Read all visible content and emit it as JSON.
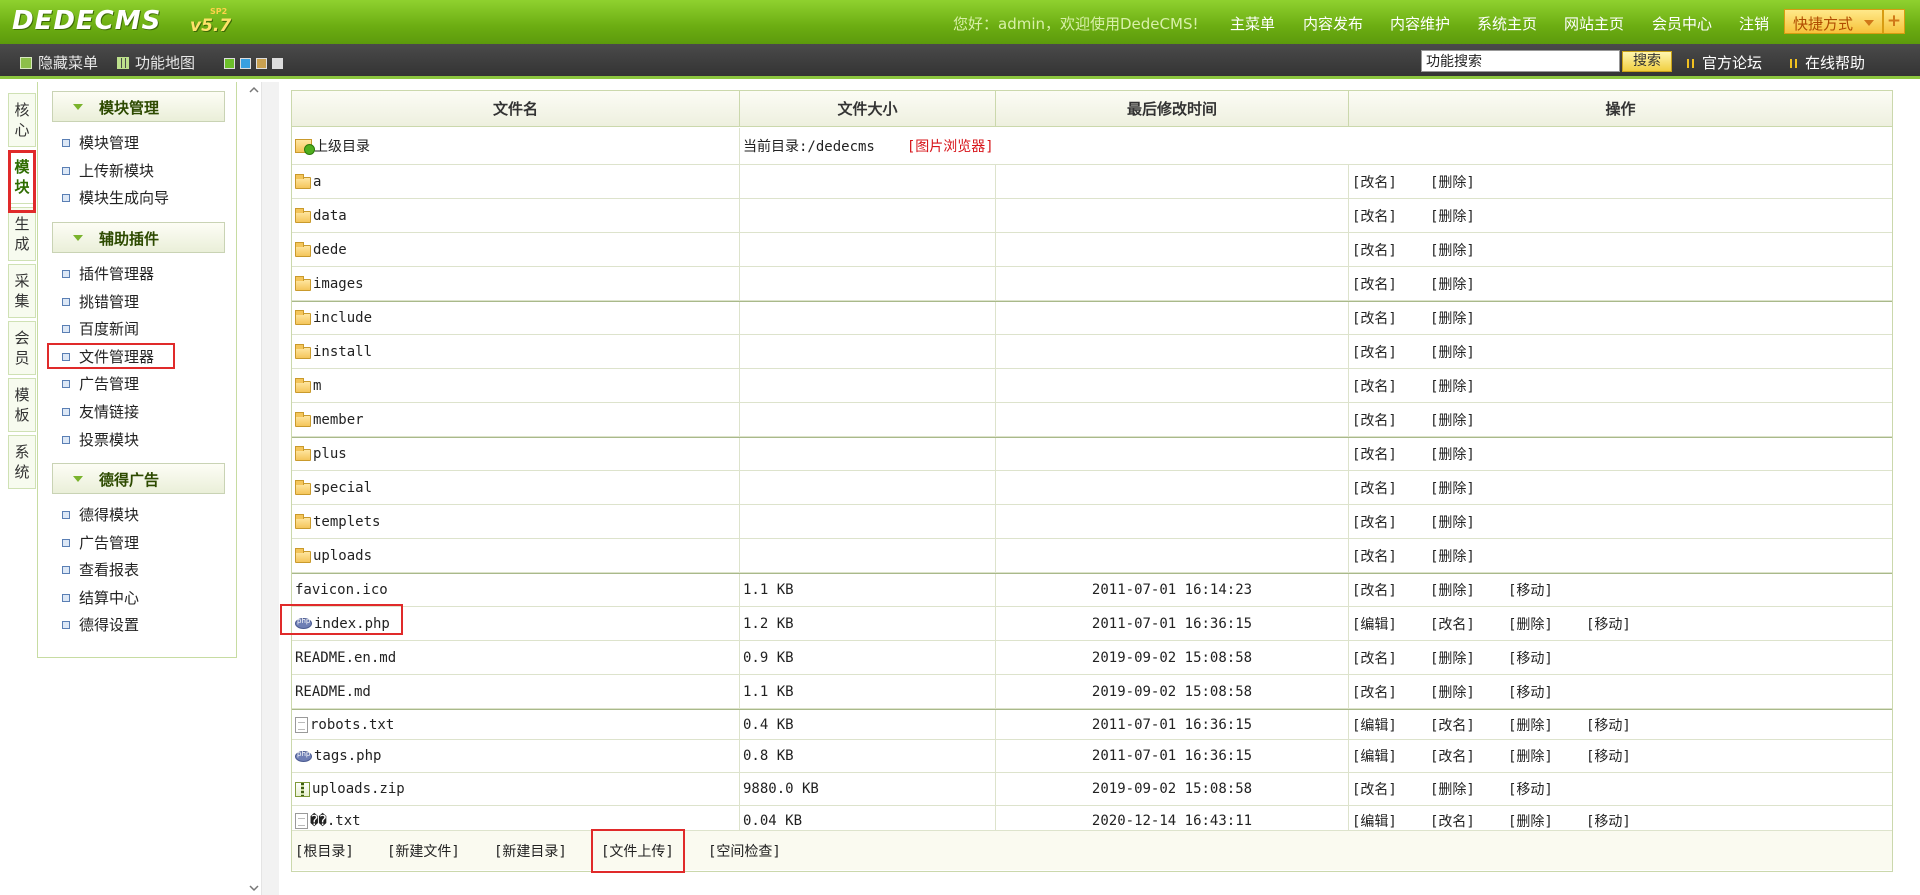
{
  "header": {
    "logo": "DEDECMS",
    "version": "v5.7",
    "version_tag": "SP2",
    "welcome": "您好：admin，欢迎使用DedeCMS!",
    "nav": [
      "主菜单",
      "内容发布",
      "内容维护",
      "系统主页",
      "网站主页",
      "会员中心",
      "注销"
    ],
    "quick_label": "快捷方式",
    "quick_plus": "+"
  },
  "toolbar": {
    "hide_menu": "隐藏菜单",
    "site_map": "功能地图",
    "swatch_colors": [
      "#6cbf2a",
      "#3aa0e0",
      "#c8a050",
      "#dcdcdc"
    ],
    "search_value": "功能搜索",
    "search_button": "搜索",
    "forum": "官方论坛",
    "help": "在线帮助"
  },
  "vtabs": [
    {
      "label": "核心",
      "active": false
    },
    {
      "label": "模块",
      "active": true
    },
    {
      "label": "生成",
      "active": false
    },
    {
      "label": "采集",
      "active": false
    },
    {
      "label": "会员",
      "active": false
    },
    {
      "label": "模板",
      "active": false
    },
    {
      "label": "系统",
      "active": false
    }
  ],
  "menu": {
    "groups": [
      {
        "title": "模块管理",
        "items": [
          "模块管理",
          "上传新模块",
          "模块生成向导"
        ]
      },
      {
        "title": "辅助插件",
        "items": [
          "插件管理器",
          "挑错管理",
          "百度新闻",
          "文件管理器",
          "广告管理",
          "友情链接",
          "投票模块"
        ]
      },
      {
        "title": "德得广告",
        "items": [
          "德得模块",
          "广告管理",
          "查看报表",
          "结算中心",
          "德得设置"
        ]
      }
    ],
    "selected": "文件管理器"
  },
  "table": {
    "headers": [
      "文件名",
      "文件大小",
      "最后修改时间",
      "操作"
    ],
    "parent_dir": "上级目录",
    "current_dir": "当前目录:/dedecms",
    "image_browser": "[图片浏览器]",
    "rows": [
      {
        "icon": "folder-icon",
        "name": "a",
        "size": "",
        "time": "",
        "ops": [
          "[改名]",
          "[删除]"
        ]
      },
      {
        "icon": "folder-icon",
        "name": "data",
        "size": "",
        "time": "",
        "ops": [
          "[改名]",
          "[删除]"
        ]
      },
      {
        "icon": "folder-icon",
        "name": "dede",
        "size": "",
        "time": "",
        "ops": [
          "[改名]",
          "[删除]"
        ]
      },
      {
        "icon": "folder-icon",
        "name": "images",
        "size": "",
        "time": "",
        "ops": [
          "[改名]",
          "[删除]"
        ]
      },
      {
        "icon": "folder-icon",
        "name": "include",
        "size": "",
        "time": "",
        "ops": [
          "[改名]",
          "[删除]"
        ]
      },
      {
        "icon": "folder-icon",
        "name": "install",
        "size": "",
        "time": "",
        "ops": [
          "[改名]",
          "[删除]"
        ]
      },
      {
        "icon": "folder-icon",
        "name": "m",
        "size": "",
        "time": "",
        "ops": [
          "[改名]",
          "[删除]"
        ]
      },
      {
        "icon": "folder-icon",
        "name": "member",
        "size": "",
        "time": "",
        "ops": [
          "[改名]",
          "[删除]"
        ]
      },
      {
        "icon": "folder-icon",
        "name": "plus",
        "size": "",
        "time": "",
        "ops": [
          "[改名]",
          "[删除]"
        ]
      },
      {
        "icon": "folder-icon",
        "name": "special",
        "size": "",
        "time": "",
        "ops": [
          "[改名]",
          "[删除]"
        ]
      },
      {
        "icon": "folder-icon",
        "name": "templets",
        "size": "",
        "time": "",
        "ops": [
          "[改名]",
          "[删除]"
        ]
      },
      {
        "icon": "folder-icon",
        "name": "uploads",
        "size": "",
        "time": "",
        "ops": [
          "[改名]",
          "[删除]"
        ]
      },
      {
        "icon": "",
        "name": "favicon.ico",
        "size": "1.1 KB",
        "time": "2011-07-01 16:14:23",
        "ops": [
          "[改名]",
          "[删除]",
          "[移动]"
        ]
      },
      {
        "icon": "php-file-icon",
        "name": "index.php",
        "size": "1.2 KB",
        "time": "2011-07-01 16:36:15",
        "ops": [
          "[编辑]",
          "[改名]",
          "[删除]",
          "[移动]"
        ]
      },
      {
        "icon": "",
        "name": "README.en.md",
        "size": "0.9 KB",
        "time": "2019-09-02 15:08:58",
        "ops": [
          "[改名]",
          "[删除]",
          "[移动]"
        ]
      },
      {
        "icon": "",
        "name": "README.md",
        "size": "1.1 KB",
        "time": "2019-09-02 15:08:58",
        "ops": [
          "[改名]",
          "[删除]",
          "[移动]"
        ]
      },
      {
        "icon": "text-file-icon",
        "name": "robots.txt",
        "size": "0.4 KB",
        "time": "2011-07-01 16:36:15",
        "ops": [
          "[编辑]",
          "[改名]",
          "[删除]",
          "[移动]"
        ]
      },
      {
        "icon": "php-file-icon",
        "name": "tags.php",
        "size": "0.8 KB",
        "time": "2011-07-01 16:36:15",
        "ops": [
          "[编辑]",
          "[改名]",
          "[删除]",
          "[移动]"
        ]
      },
      {
        "icon": "zip-file-icon",
        "name": "uploads.zip",
        "size": "9880.0 KB",
        "time": "2019-09-02 15:08:58",
        "ops": [
          "[改名]",
          "[删除]",
          "[移动]"
        ]
      },
      {
        "icon": "text-file-icon",
        "name": "��.txt",
        "size": "0.04 KB",
        "time": "2020-12-14 16:43:11",
        "ops": [
          "[编辑]",
          "[改名]",
          "[删除]",
          "[移动]"
        ]
      }
    ],
    "footer": [
      "[根目录]",
      "[新建文件]",
      "[新建目录]",
      "[文件上传]",
      "[空间检查]"
    ]
  }
}
